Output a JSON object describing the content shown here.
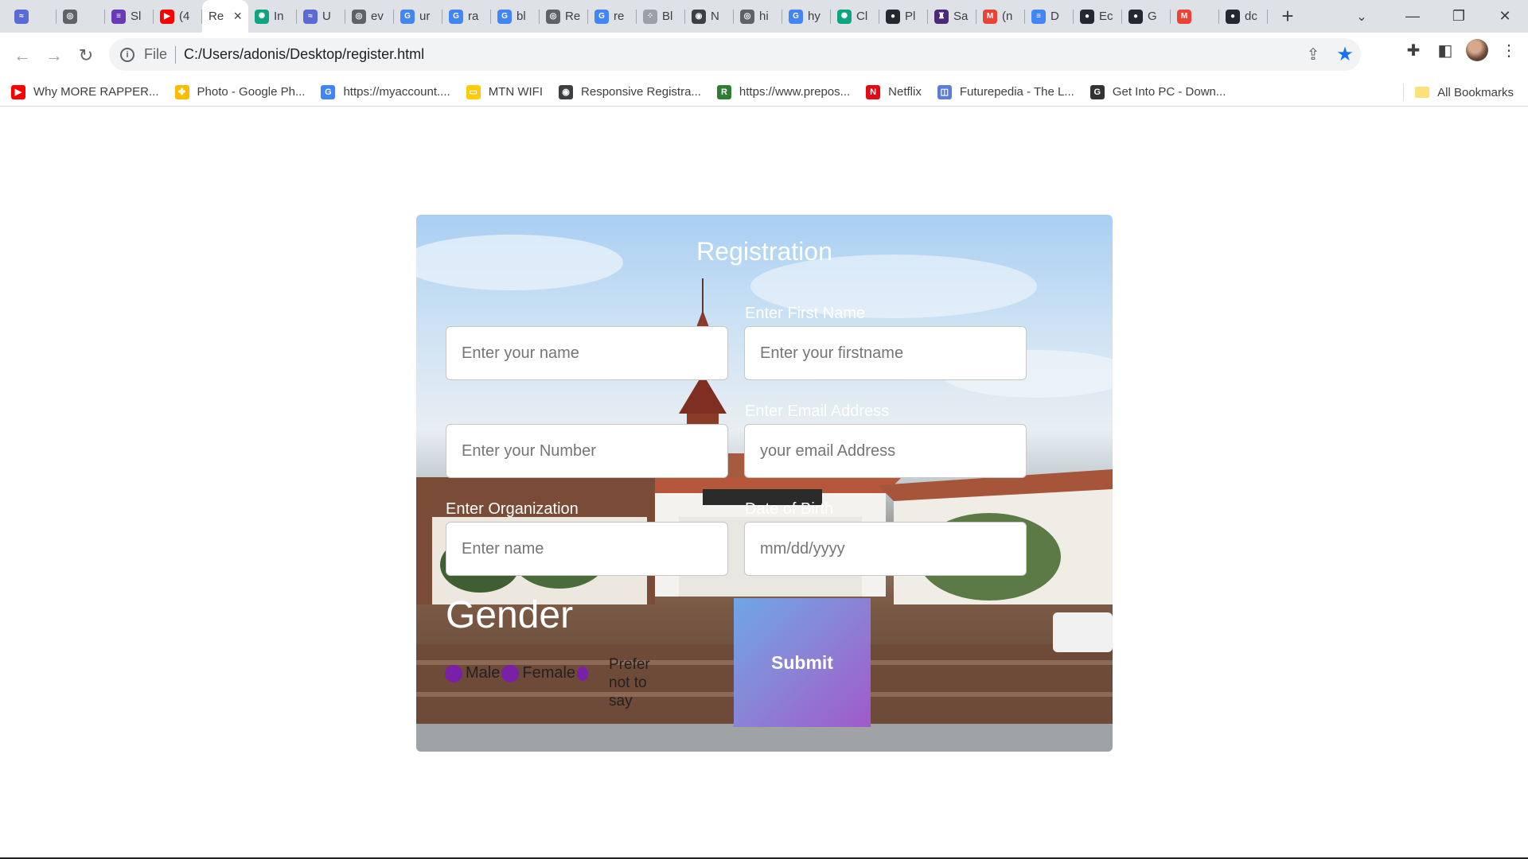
{
  "browser": {
    "tabs": [
      {
        "label": "",
        "icon": "ae-icon",
        "color": "#5b6bd6",
        "glyph": "≈"
      },
      {
        "label": "",
        "icon": "globe-icon",
        "color": "#5f6368",
        "glyph": "◎"
      },
      {
        "label": "Sl",
        "icon": "list-icon",
        "color": "#673ab7",
        "glyph": "≡"
      },
      {
        "label": "(4",
        "icon": "youtube-icon",
        "color": "#ff0000",
        "glyph": "▶"
      },
      {
        "label": "Re",
        "icon": "",
        "color": "",
        "glyph": "",
        "active": true
      },
      {
        "label": "In",
        "icon": "openai-icon",
        "color": "#10a37f",
        "glyph": "✺"
      },
      {
        "label": "U",
        "icon": "ae-icon",
        "color": "#5b6bd6",
        "glyph": "≈"
      },
      {
        "label": "ev",
        "icon": "globe-icon",
        "color": "#5f6368",
        "glyph": "◎"
      },
      {
        "label": "ur",
        "icon": "google-icon",
        "color": "#4285f4",
        "glyph": "G"
      },
      {
        "label": "ra",
        "icon": "google-icon",
        "color": "#4285f4",
        "glyph": "G"
      },
      {
        "label": "bl",
        "icon": "google-icon",
        "color": "#4285f4",
        "glyph": "G"
      },
      {
        "label": "Re",
        "icon": "globe-icon",
        "color": "#5f6368",
        "glyph": "◎"
      },
      {
        "label": "re",
        "icon": "google-icon",
        "color": "#4285f4",
        "glyph": "G"
      },
      {
        "label": "Bl",
        "icon": "dots-icon",
        "color": "#9aa0a6",
        "glyph": "⁘"
      },
      {
        "label": "N",
        "icon": "chrome-icon",
        "color": "#3c4043",
        "glyph": "◉"
      },
      {
        "label": "hi",
        "icon": "globe-icon",
        "color": "#5f6368",
        "glyph": "◎"
      },
      {
        "label": "hy",
        "icon": "google-icon",
        "color": "#4285f4",
        "glyph": "G"
      },
      {
        "label": "Cl",
        "icon": "openai-icon",
        "color": "#10a37f",
        "glyph": "✺"
      },
      {
        "label": "Pl",
        "icon": "github-icon",
        "color": "#24292f",
        "glyph": "●"
      },
      {
        "label": "Sa",
        "icon": "shield-icon",
        "color": "#4a2a7a",
        "glyph": "♜"
      },
      {
        "label": "(n",
        "icon": "gmail-icon",
        "color": "#ea4335",
        "glyph": "M"
      },
      {
        "label": "D",
        "icon": "docs-icon",
        "color": "#4285f4",
        "glyph": "≡"
      },
      {
        "label": "Ec",
        "icon": "github-icon",
        "color": "#24292f",
        "glyph": "●"
      },
      {
        "label": "G",
        "icon": "github-icon",
        "color": "#24292f",
        "glyph": "●"
      },
      {
        "label": "",
        "icon": "gmail-icon",
        "color": "#ea4335",
        "glyph": "M"
      },
      {
        "label": "dc",
        "icon": "github-icon",
        "color": "#24292f",
        "glyph": "●"
      }
    ],
    "scheme": "File",
    "url": "C:/Users/adonis/Desktop/register.html",
    "bookmarks": [
      {
        "label": "Why MORE RAPPER...",
        "icon": "youtube-icon",
        "color": "#ff0000",
        "glyph": "▶"
      },
      {
        "label": "Photo - Google Ph...",
        "icon": "pinwheel-icon",
        "color": "#fbbc04",
        "glyph": "✤"
      },
      {
        "label": "https://myaccount....",
        "icon": "google-icon",
        "color": "#4285f4",
        "glyph": "G"
      },
      {
        "label": "MTN WIFI",
        "icon": "mtn-icon",
        "color": "#ffcb05",
        "glyph": "▭"
      },
      {
        "label": "Responsive Registra...",
        "icon": "chrome-icon",
        "color": "#3c4043",
        "glyph": "◉"
      },
      {
        "label": "https://www.prepos...",
        "icon": "prepostseo-icon",
        "color": "#2e7d32",
        "glyph": "R"
      },
      {
        "label": "Netflix",
        "icon": "netflix-icon",
        "color": "#e50914",
        "glyph": "N"
      },
      {
        "label": "Futurepedia - The L...",
        "icon": "futurepedia-icon",
        "color": "#5b7fd6",
        "glyph": "◫"
      },
      {
        "label": "Get Into PC - Down...",
        "icon": "getintopc-icon",
        "color": "#333333",
        "glyph": "G"
      }
    ],
    "all_bookmarks": "All Bookmarks"
  },
  "form": {
    "title": "Registration",
    "first_name_label": "Enter First Name",
    "email_label": "Enter Email Address",
    "org_label": "Enter Organization",
    "dob_label": "Date of Birth",
    "name_placeholder": "Enter your name",
    "firstname_placeholder": "Enter your firstname",
    "number_placeholder": "Enter your Number",
    "email_placeholder": "your email Address",
    "org_placeholder": "Enter name",
    "dob_placeholder": "mm/dd/yyyy",
    "gender_title": "Gender",
    "gender_options": [
      "Male",
      "Female",
      "Prefer not to say"
    ],
    "submit_label": "Submit"
  }
}
